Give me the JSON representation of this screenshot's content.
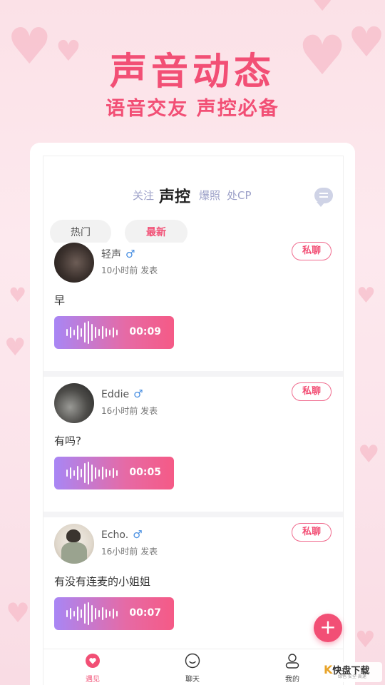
{
  "hero": {
    "title": "声音动态",
    "subtitle": "语音交友  声控必备"
  },
  "tabs": [
    "关注",
    "声控",
    "爆照",
    "处CP"
  ],
  "filters": {
    "hot": "热门",
    "new": "最新"
  },
  "posts": [
    {
      "name": "轻声",
      "gender": "♂",
      "time": "10小时前 发表",
      "private_label": "私聊",
      "text": "早",
      "duration": "00:09"
    },
    {
      "name": "Eddie",
      "gender": "♂",
      "time": "16小时前 发表",
      "private_label": "私聊",
      "text": "有吗?",
      "duration": "00:05"
    },
    {
      "name": "Echo.",
      "gender": "♂",
      "time": "16小时前 发表",
      "private_label": "私聊",
      "text": "有没有连麦的小姐姐",
      "duration": "00:07"
    }
  ],
  "fab": "+",
  "nav": {
    "meet": "遇见",
    "chat": "聊天",
    "mine": "我的"
  },
  "watermark": {
    "text": "快盘下载",
    "sub": "绿色·安全·高速"
  },
  "colors": {
    "accent": "#f24f75",
    "tab_inactive": "#9ca0c8",
    "gender": "#4a90e2"
  }
}
